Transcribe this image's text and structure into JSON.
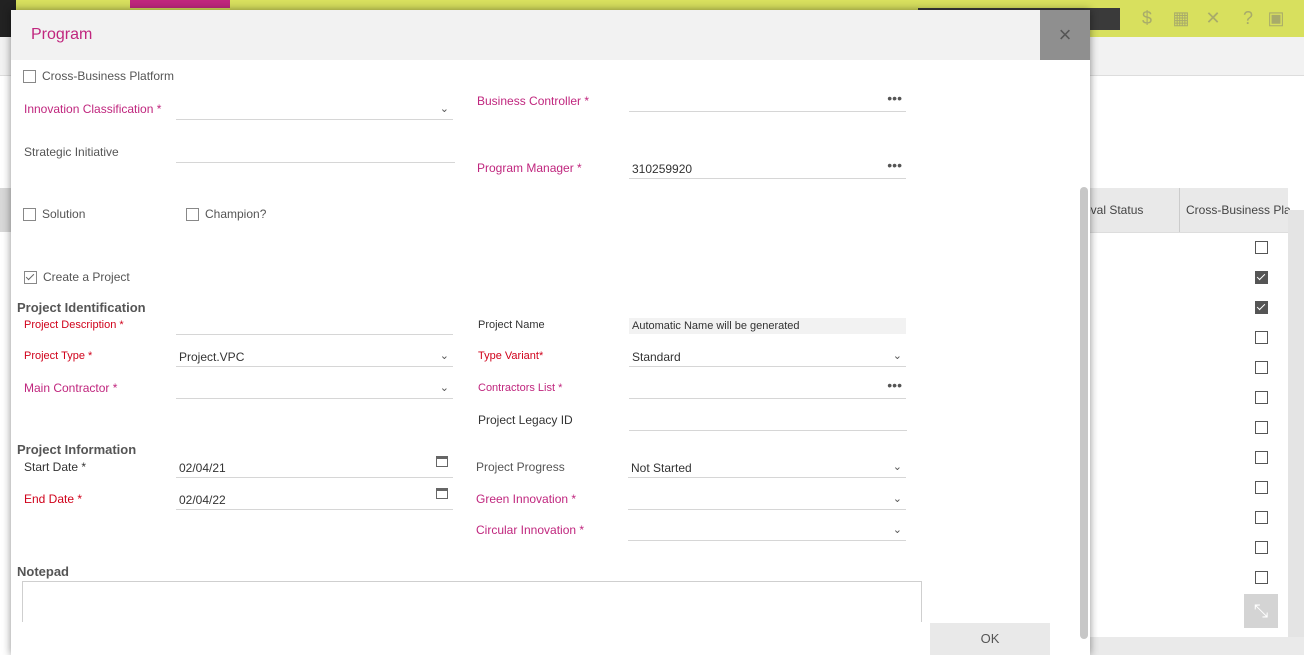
{
  "background": {
    "grid_columns": [
      "oval Status",
      "Cross-Business Pla"
    ],
    "checkbox_states": [
      false,
      true,
      true,
      false,
      false,
      false,
      false,
      false,
      false,
      false,
      false,
      false,
      false
    ]
  },
  "dialog": {
    "title": "Program",
    "close_icon": "×",
    "cross_business_platform": "Cross-Business Platform",
    "innovation_classification": "Innovation Classification *",
    "business_controller": "Business Controller *",
    "strategic_initiative": "Strategic Initiative",
    "program_manager_label": "Program Manager *",
    "program_manager_value": "310259920",
    "solution": "Solution",
    "champion": "Champion?",
    "create_project": "Create a Project",
    "project_identification": "Project Identification",
    "project_description": "Project Description *",
    "project_name_label": "Project Name",
    "project_name_value": "Automatic Name will be generated",
    "project_type_label": "Project Type *",
    "project_type_value": "Project.VPC",
    "type_variant_label": "Type Variant*",
    "type_variant_value": "Standard",
    "main_contractor": "Main Contractor *",
    "contractors_list": "Contractors List *",
    "project_legacy_id": "Project Legacy ID",
    "project_information": "Project Information",
    "start_date_label": "Start Date *",
    "start_date_value": "02/04/21",
    "project_progress_label": "Project Progress",
    "project_progress_value": "Not Started",
    "end_date_label": "End Date *",
    "end_date_value": "02/04/22",
    "green_innovation": "Green Innovation *",
    "circular_innovation": "Circular Innovation *",
    "notepad": "Notepad",
    "ok": "OK"
  },
  "icons": {
    "chevron": "⌄",
    "dots": "•••"
  },
  "colors": {
    "accent": "#c0267e",
    "required_red": "#d0021b",
    "topbar": "#d8e05e"
  }
}
